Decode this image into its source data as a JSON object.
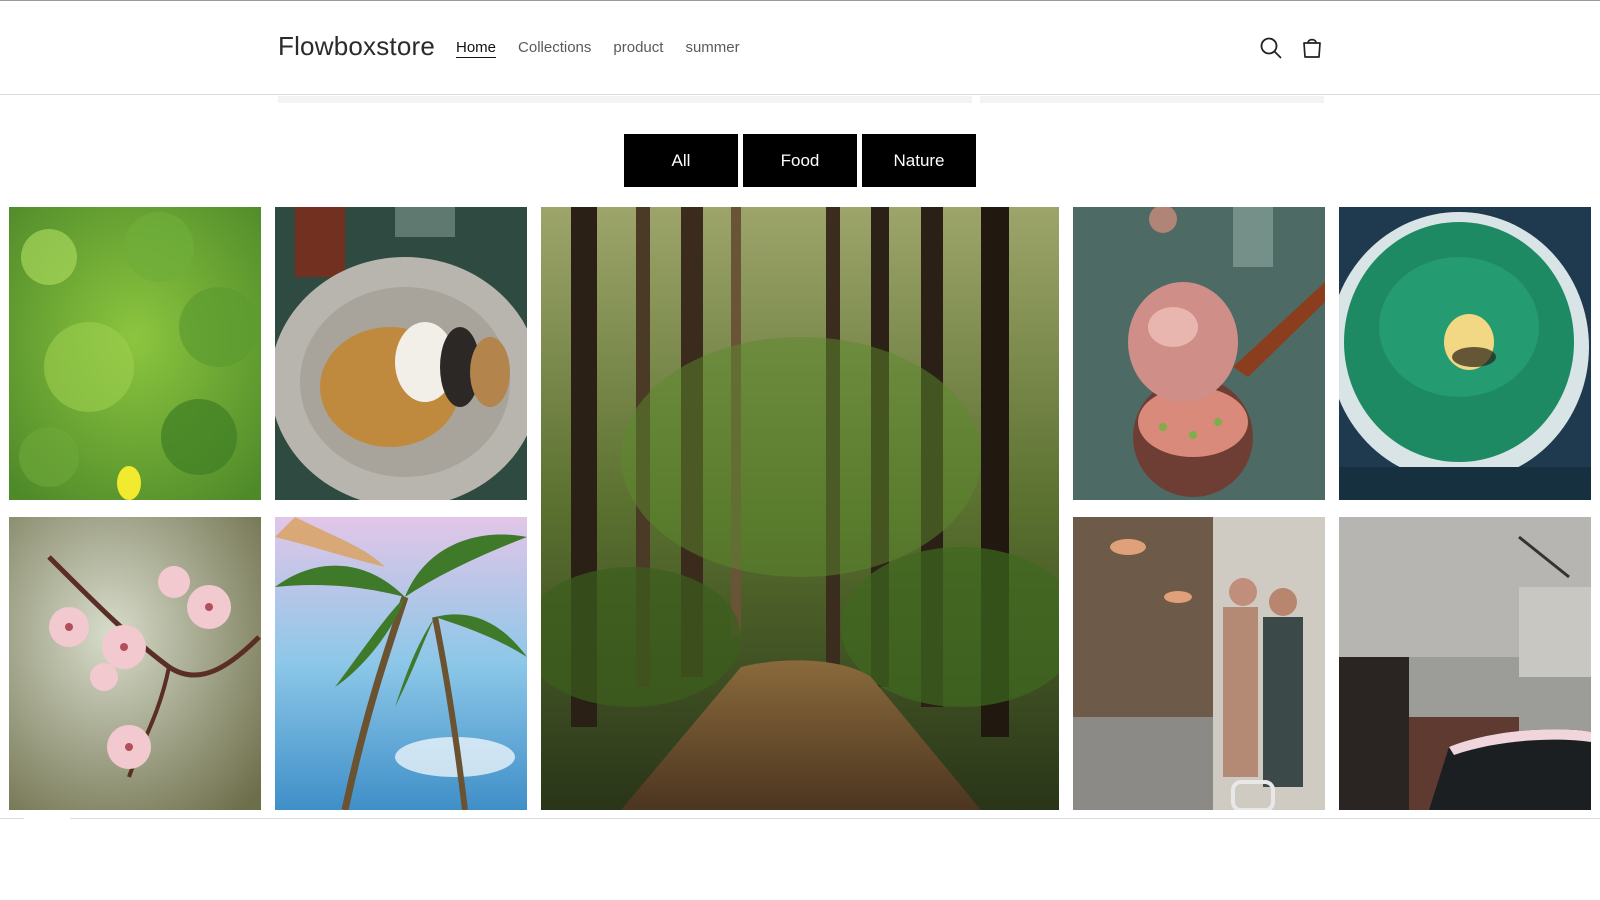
{
  "header": {
    "logo": "Flowboxstore",
    "nav": [
      {
        "label": "Home",
        "active": true
      },
      {
        "label": "Collections",
        "active": false
      },
      {
        "label": "product",
        "active": false
      },
      {
        "label": "summer",
        "active": false
      }
    ],
    "icons": [
      "search-icon",
      "cart-icon"
    ]
  },
  "filters": {
    "all": "All",
    "food": "Food",
    "nature": "Nature"
  },
  "gallery": {
    "tiles": [
      {
        "name": "green-leaves-photo"
      },
      {
        "name": "soup-bowl-photo"
      },
      {
        "name": "forest-path-photo"
      },
      {
        "name": "dessert-spoon-photo"
      },
      {
        "name": "green-bowl-photo"
      },
      {
        "name": "cherry-blossom-photo"
      },
      {
        "name": "palm-trees-photo"
      },
      {
        "name": "shop-window-photo"
      },
      {
        "name": "old-building-car-photo"
      }
    ]
  },
  "colors": {
    "filter_button_bg": "#000000",
    "filter_button_text": "#ffffff",
    "accent_text": "#121212"
  }
}
